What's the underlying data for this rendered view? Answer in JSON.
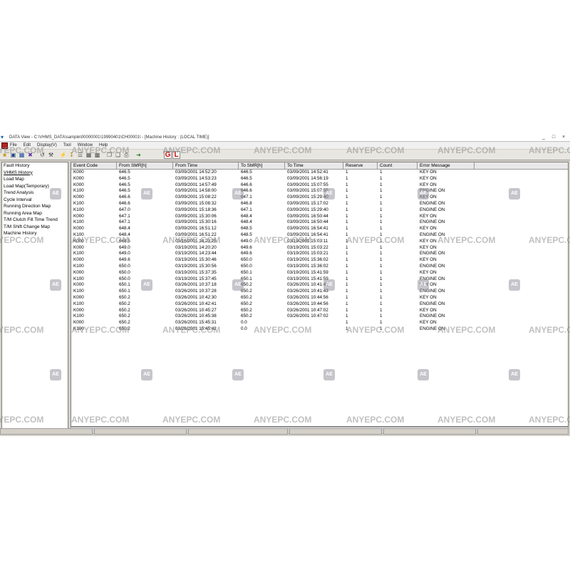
{
  "window": {
    "title": "DATA View - C:\\VHMS_DATA\\sample\\00000001\\19990401\\CH00001\\ - [Machine History : (LOCAL TIME)]",
    "buttons": [
      "_",
      "□",
      "×"
    ]
  },
  "menu": [
    "File",
    "Edit",
    "Display(V)",
    "Tool",
    "Window",
    "Help"
  ],
  "toolbar": {
    "gl_label_g": "G",
    "gl_label_l": "L"
  },
  "sidebar": {
    "items": [
      "Fault History",
      "VHMS History",
      "Load Map",
      "Load Map(Temporary)",
      "Trend Analysis",
      "Cycle Interval",
      "Running Direction Map",
      "Running Area Map",
      "T/M Clutch Fill Time Trend",
      "T/M Shift Change Map",
      "Machine History"
    ]
  },
  "table": {
    "columns": [
      "Event Code",
      "From SMR[h]",
      "From Time",
      "To SMR[h]",
      "To Time",
      "Reserve",
      "Count",
      "Error Message"
    ],
    "rows": [
      [
        "K000",
        "646.5",
        "03/09/2001 14:52:20",
        "646.5",
        "03/09/2001 14:52:41",
        "1",
        "1",
        "KEY ON"
      ],
      [
        "K000",
        "646.5",
        "03/09/2001 14:53:23",
        "646.5",
        "03/09/2001 14:56:19",
        "1",
        "1",
        "KEY ON"
      ],
      [
        "K000",
        "646.5",
        "03/09/2001 14:57:49",
        "646.6",
        "03/09/2001 15:07:55",
        "1",
        "1",
        "KEY ON"
      ],
      [
        "K100",
        "646.5",
        "03/09/2001 14:58:00",
        "646.6",
        "03/09/2001 15:07:55",
        "1",
        "1",
        "ENGINE ON"
      ],
      [
        "K000",
        "646.6",
        "03/09/2001 15:08:22",
        "647.1",
        "03/09/2001 15:29:40",
        "1",
        "1",
        "KEY ON"
      ],
      [
        "K100",
        "646.6",
        "03/09/2001 15:08:32",
        "646.8",
        "03/09/2001 15:17:02",
        "1",
        "1",
        "ENGINE ON"
      ],
      [
        "K100",
        "647.0",
        "03/09/2001 15:18:36",
        "647.1",
        "03/09/2001 15:29:40",
        "1",
        "1",
        "ENGINE ON"
      ],
      [
        "K000",
        "647.1",
        "03/09/2001 15:30:06",
        "648.4",
        "03/09/2001 16:50:44",
        "1",
        "1",
        "KEY ON"
      ],
      [
        "K100",
        "647.1",
        "03/09/2001 15:30:16",
        "648.4",
        "03/09/2001 16:50:44",
        "1",
        "1",
        "ENGINE ON"
      ],
      [
        "K000",
        "648.4",
        "03/09/2001 16:51:12",
        "648.5",
        "03/09/2001 16:54:41",
        "1",
        "1",
        "KEY ON"
      ],
      [
        "K100",
        "648.4",
        "03/09/2001 16:51:22",
        "648.5",
        "03/09/2001 16:54:41",
        "1",
        "1",
        "ENGINE ON"
      ],
      [
        "K000",
        "648.5",
        "03/16/2001 14:23:25",
        "649.0",
        "03/19/2001 15:03:11",
        "1",
        "1",
        "KEY ON"
      ],
      [
        "K000",
        "649.0",
        "03/19/2001 14:20:20",
        "649.6",
        "03/19/2001 15:03:22",
        "1",
        "1",
        "KEY ON"
      ],
      [
        "K100",
        "649.0",
        "03/19/2001 14:23:44",
        "649.6",
        "03/19/2001 15:03:21",
        "1",
        "1",
        "ENGINE ON"
      ],
      [
        "K000",
        "649.6",
        "03/19/2001 15:30:46",
        "650.0",
        "03/19/2001 15:36:02",
        "1",
        "1",
        "KEY ON"
      ],
      [
        "K100",
        "650.0",
        "03/19/2001 15:30:56",
        "650.0",
        "03/19/2001 15:36:02",
        "1",
        "1",
        "ENGINE ON"
      ],
      [
        "K000",
        "650.0",
        "03/19/2001 15:37:35",
        "650.1",
        "03/19/2001 15:41:59",
        "1",
        "1",
        "KEY ON"
      ],
      [
        "K100",
        "650.0",
        "03/19/2001 15:37:45",
        "650.1",
        "03/19/2001 15:41:59",
        "1",
        "1",
        "ENGINE ON"
      ],
      [
        "K000",
        "650.1",
        "03/26/2001 10:37:18",
        "650.2",
        "03/26/2001 10:41:43",
        "1",
        "1",
        "KEY ON"
      ],
      [
        "K100",
        "650.1",
        "03/26/2001 10:37:28",
        "650.2",
        "03/26/2001 10:41:43",
        "1",
        "1",
        "ENGINE ON"
      ],
      [
        "K000",
        "650.2",
        "03/26/2001 10:42:30",
        "650.2",
        "03/26/2001 10:44:56",
        "1",
        "1",
        "KEY ON"
      ],
      [
        "K100",
        "650.2",
        "03/26/2001 10:42:41",
        "650.2",
        "03/26/2001 10:44:56",
        "1",
        "1",
        "ENGINE ON"
      ],
      [
        "K000",
        "650.2",
        "03/26/2001 10:45:27",
        "650.2",
        "03/26/2001 10:47:02",
        "1",
        "1",
        "KEY ON"
      ],
      [
        "K100",
        "650.2",
        "03/26/2001 10:45:38",
        "650.2",
        "03/26/2001 10:47:02",
        "1",
        "1",
        "ENGINE ON"
      ],
      [
        "K000",
        "650.2",
        "03/26/2001 15:45:31",
        "0.0",
        "",
        "1",
        "1",
        "KEY ON"
      ],
      [
        "K100",
        "650.2",
        "03/26/2001 15:45:42",
        "0.0",
        "",
        "1",
        "1",
        "ENGINE ON"
      ]
    ]
  },
  "watermark": {
    "text": "ANYEPC.COM",
    "logo": "AE"
  }
}
